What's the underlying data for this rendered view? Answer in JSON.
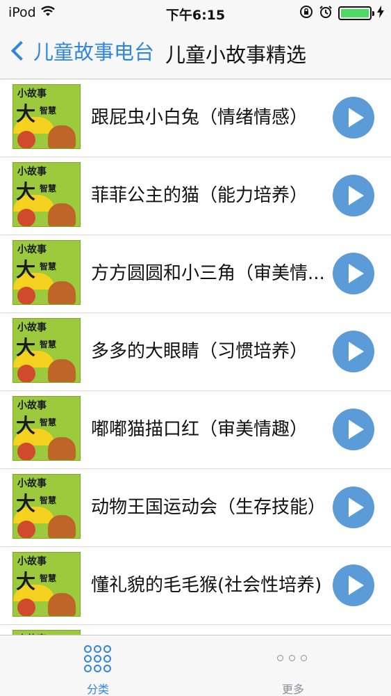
{
  "status_bar": {
    "carrier": "iPod",
    "time": "下午6:15"
  },
  "nav": {
    "back_label": "儿童故事电台",
    "title": "儿童小故事精选"
  },
  "thumbnail": {
    "top_text": "小故事",
    "big_text": "大",
    "small_text": "智慧"
  },
  "items": [
    {
      "title": "跟屁虫小白兔（情绪情感）"
    },
    {
      "title": "菲菲公主的猫（能力培养）"
    },
    {
      "title": "方方圆圆和小三角（审美情..."
    },
    {
      "title": "多多的大眼睛（习惯培养）"
    },
    {
      "title": "嘟嘟猫描口红（审美情趣）"
    },
    {
      "title": "动物王国运动会（生存技能）"
    },
    {
      "title": "懂礼貌的毛毛猴(社会性培养)"
    }
  ],
  "tabs": [
    {
      "label": "分类",
      "active": true
    },
    {
      "label": "更多",
      "active": false
    }
  ],
  "colors": {
    "accent": "#2f86e0",
    "play_button": "#5b9bd8",
    "thumb_bg": "#9bcb3c",
    "inactive_tab": "#8e8e93"
  }
}
